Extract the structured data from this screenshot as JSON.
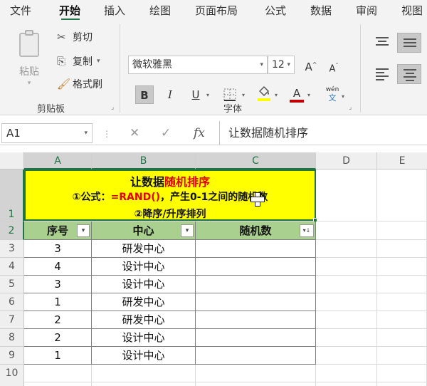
{
  "tabs": [
    "文件",
    "开始",
    "插入",
    "绘图",
    "页面布局",
    "公式",
    "数据",
    "审阅",
    "视图"
  ],
  "clipboard": {
    "paste_label": "粘贴",
    "cut_label": "剪切",
    "copy_label": "复制",
    "format_painter_label": "格式刷",
    "group_label": "剪贴板"
  },
  "font": {
    "name": "微软雅黑",
    "size": "12",
    "grow_label": "A",
    "shrink_label": "A",
    "bold_label": "B",
    "italic_label": "I",
    "underline_label": "U",
    "font_color_label": "A",
    "phonetic_top": "wén",
    "phonetic_bottom": "文",
    "group_label": "字体",
    "font_color": "#c00000"
  },
  "formula_bar": {
    "name_box": "A1",
    "cancel_symbol": "✕",
    "enter_symbol": "✓",
    "fx_symbol": "fx",
    "formula": "让数据随机排序"
  },
  "columns": [
    "A",
    "B",
    "C",
    "D",
    "E"
  ],
  "rows": [
    "1",
    "2",
    "3",
    "4",
    "5",
    "6",
    "7",
    "8",
    "9",
    "10"
  ],
  "title_block": {
    "line1_black": "让数据",
    "line1_red": "随机排序",
    "line2_prefix": "①公式：",
    "line2_red": "=RAND()",
    "line2_suffix": "，产生0-1之间的随机数",
    "line3": "②降序/升序排列"
  },
  "table": {
    "headers": [
      "序号",
      "中心",
      "随机数"
    ],
    "filter_symbol": "▾",
    "sorted_filter_symbol": "▾↓",
    "rows": [
      {
        "seq": "3",
        "center": "研发中心",
        "random": ""
      },
      {
        "seq": "4",
        "center": "设计中心",
        "random": ""
      },
      {
        "seq": "3",
        "center": "设计中心",
        "random": ""
      },
      {
        "seq": "1",
        "center": "研发中心",
        "random": ""
      },
      {
        "seq": "2",
        "center": "研发中心",
        "random": ""
      },
      {
        "seq": "2",
        "center": "设计中心",
        "random": ""
      },
      {
        "seq": "1",
        "center": "设计中心",
        "random": ""
      }
    ]
  },
  "colors": {
    "accent": "#217346",
    "title_fill": "#ffff00",
    "header_fill": "#a9d08e",
    "emphasis_red": "#e00000"
  }
}
